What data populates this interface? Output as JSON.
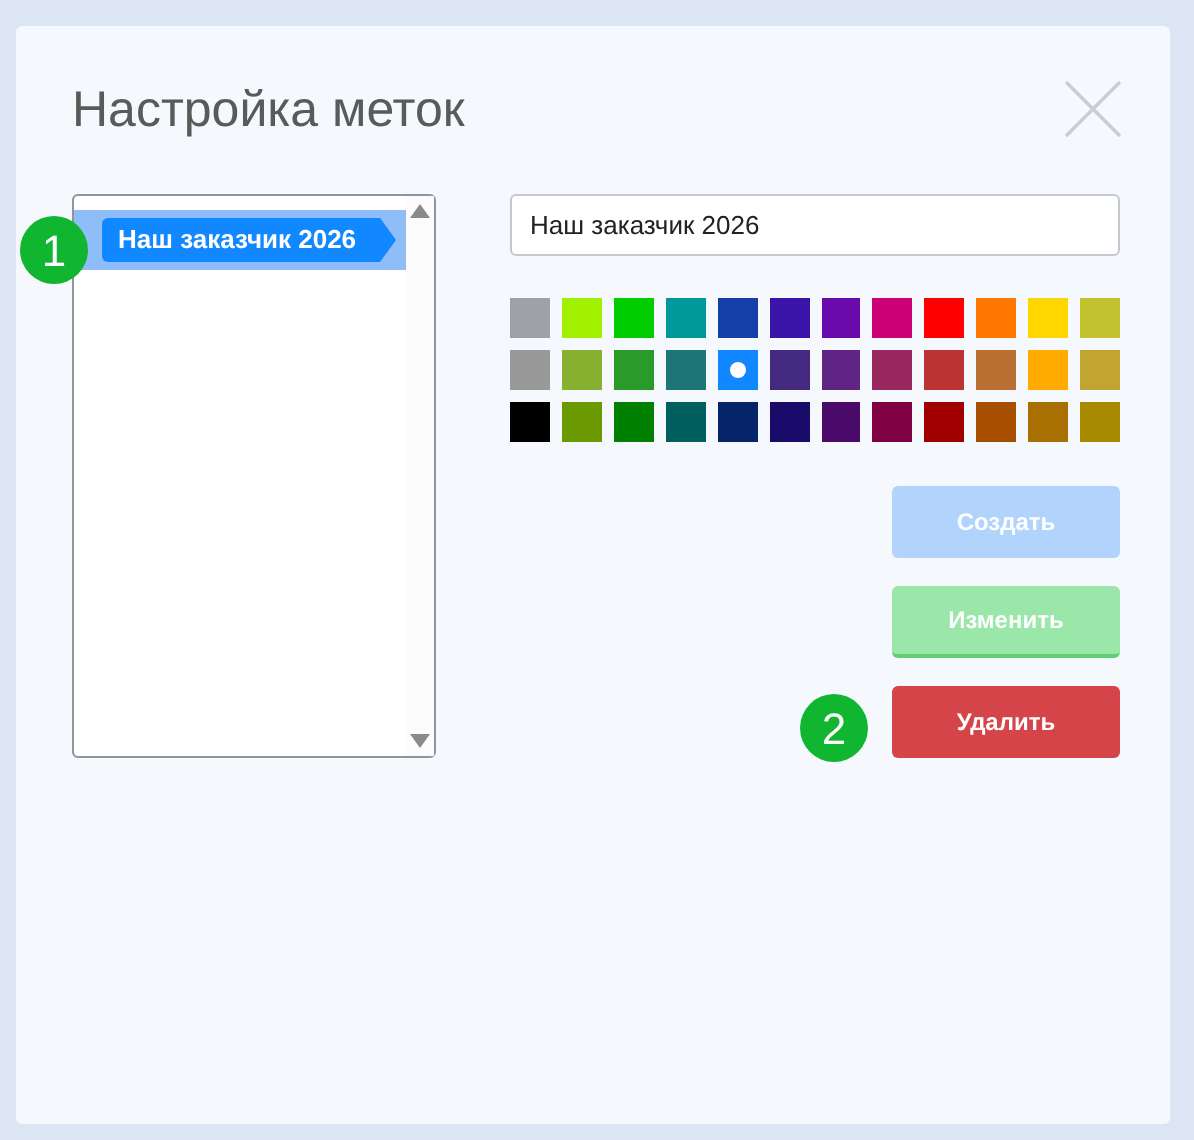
{
  "dialog": {
    "title": "Настройка меток"
  },
  "tags": [
    {
      "label": "Наш заказчик 2026",
      "color": "#1188ff",
      "selected": true
    }
  ],
  "name_field": {
    "value": "Наш заказчик 2026"
  },
  "palette": [
    [
      {
        "color": "#9ea1a5",
        "selected": false
      },
      {
        "color": "#a0f000",
        "selected": false
      },
      {
        "color": "#00cc00",
        "selected": false
      },
      {
        "color": "#009999",
        "selected": false
      },
      {
        "color": "#1540a8",
        "selected": false
      },
      {
        "color": "#3a14a8",
        "selected": false
      },
      {
        "color": "#6a0aaa",
        "selected": false
      },
      {
        "color": "#cc0077",
        "selected": false
      },
      {
        "color": "#ff0000",
        "selected": false
      },
      {
        "color": "#ff7700",
        "selected": false
      },
      {
        "color": "#ffd700",
        "selected": false
      },
      {
        "color": "#c2c22e",
        "selected": false
      }
    ],
    [
      {
        "color": "#999999",
        "selected": false
      },
      {
        "color": "#88b030",
        "selected": false
      },
      {
        "color": "#2a9a2a",
        "selected": false
      },
      {
        "color": "#1e7575",
        "selected": false
      },
      {
        "color": "#1188ff",
        "selected": true
      },
      {
        "color": "#432a80",
        "selected": false
      },
      {
        "color": "#5f2484",
        "selected": false
      },
      {
        "color": "#9a2860",
        "selected": false
      },
      {
        "color": "#bb3333",
        "selected": false
      },
      {
        "color": "#bb7033",
        "selected": false
      },
      {
        "color": "#ffaa00",
        "selected": false
      },
      {
        "color": "#c2a530",
        "selected": false
      }
    ],
    [
      {
        "color": "#000000",
        "selected": false
      },
      {
        "color": "#6a9a00",
        "selected": false
      },
      {
        "color": "#008000",
        "selected": false
      },
      {
        "color": "#006060",
        "selected": false
      },
      {
        "color": "#06246a",
        "selected": false
      },
      {
        "color": "#1a0a6a",
        "selected": false
      },
      {
        "color": "#4a0a6a",
        "selected": false
      },
      {
        "color": "#800044",
        "selected": false
      },
      {
        "color": "#a00000",
        "selected": false
      },
      {
        "color": "#a84e00",
        "selected": false
      },
      {
        "color": "#a87000",
        "selected": false
      },
      {
        "color": "#a88a00",
        "selected": false
      }
    ]
  ],
  "buttons": [
    {
      "label": "Создать",
      "kind": "create",
      "disabled": true
    },
    {
      "label": "Изменить",
      "kind": "edit",
      "disabled": true
    },
    {
      "label": "Удалить",
      "kind": "delete",
      "disabled": false
    }
  ],
  "callouts": [
    {
      "number": "1"
    },
    {
      "number": "2"
    }
  ]
}
